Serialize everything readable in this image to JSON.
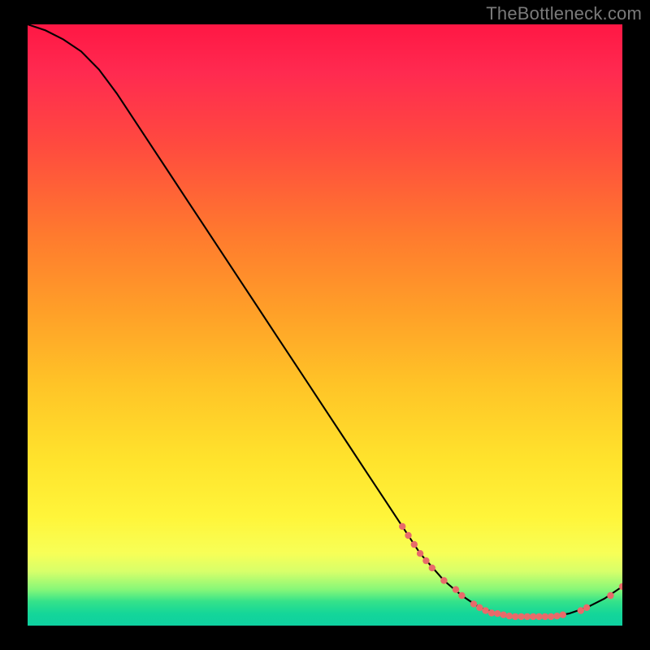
{
  "watermark": "TheBottleneck.com",
  "colors": {
    "line": "#000000",
    "marker": "#e86a6a",
    "gradient_top": "#ff1744",
    "gradient_bottom": "#0ed0a0",
    "frame": "#000000"
  },
  "chart_data": {
    "type": "line",
    "title": "",
    "xlabel": "",
    "ylabel": "",
    "xlim": [
      0,
      100
    ],
    "ylim": [
      0,
      100
    ],
    "grid": false,
    "legend": false,
    "x": [
      0,
      3,
      6,
      9,
      12,
      15,
      18,
      21,
      24,
      27,
      30,
      33,
      36,
      39,
      42,
      45,
      48,
      51,
      54,
      57,
      60,
      63,
      66,
      70,
      73,
      76,
      79,
      82,
      85,
      88,
      91,
      94,
      97,
      100
    ],
    "y": [
      100,
      99,
      97.5,
      95.5,
      92.5,
      88.5,
      84,
      79.5,
      75,
      70.5,
      66,
      61.5,
      57,
      52.5,
      48,
      43.5,
      39,
      34.5,
      30,
      25.5,
      21,
      16.5,
      12,
      7.5,
      5,
      3,
      2,
      1.5,
      1.5,
      1.5,
      2,
      3,
      4.5,
      6.5
    ],
    "markers": {
      "note": "highlighted points (pink dots) along the curve",
      "x": [
        63,
        64,
        65,
        66,
        67,
        68,
        70,
        72,
        73,
        75,
        76,
        77,
        78,
        79,
        80,
        81,
        82,
        83,
        84,
        85,
        86,
        87,
        88,
        89,
        90,
        93,
        94,
        98,
        100
      ],
      "y": [
        16.5,
        15,
        13.5,
        12,
        10.8,
        9.6,
        7.5,
        6,
        5,
        3.6,
        3,
        2.5,
        2.1,
        2,
        1.8,
        1.6,
        1.5,
        1.5,
        1.5,
        1.5,
        1.5,
        1.5,
        1.5,
        1.6,
        1.8,
        2.5,
        3,
        5,
        6.5
      ]
    }
  }
}
